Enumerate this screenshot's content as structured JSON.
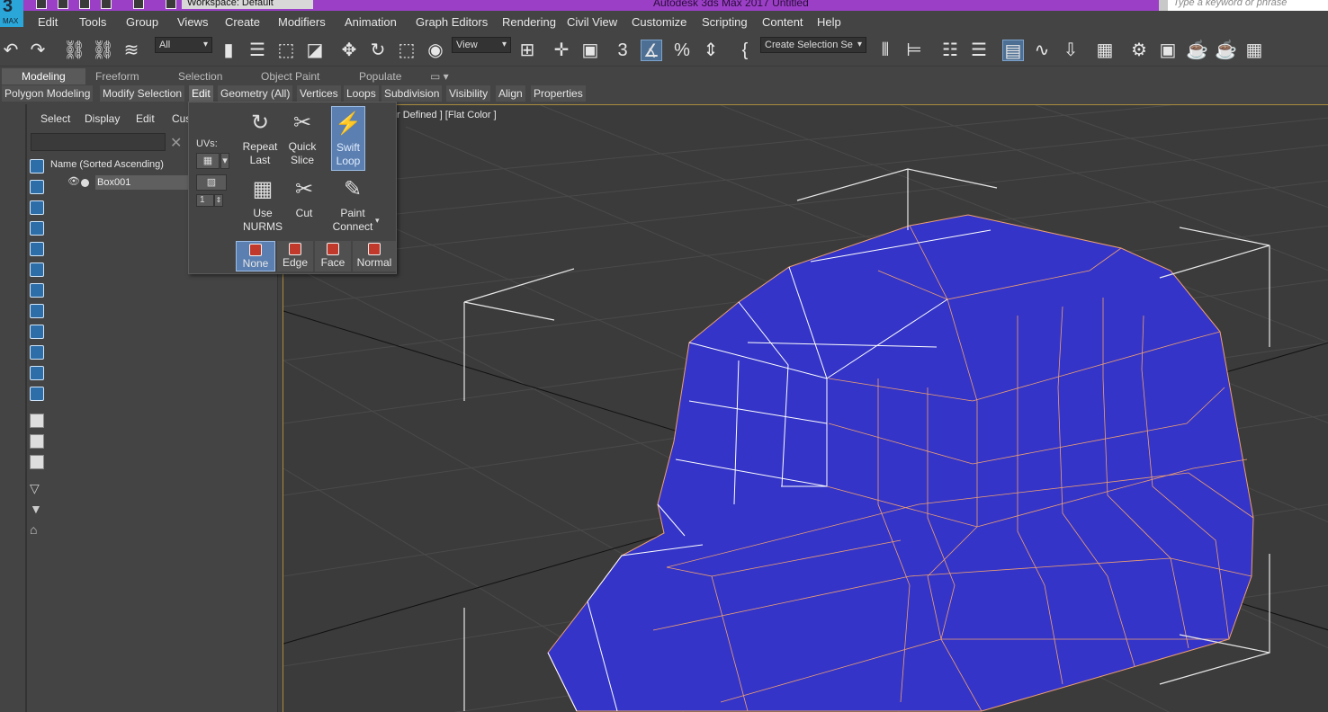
{
  "title_bar": {
    "text": "Autodesk 3ds Max 2017     Untitled",
    "workspace": "Workspace: Default",
    "search_placeholder": "Type a keyword or phrase",
    "logo": "3",
    "logo_label": "MAX"
  },
  "menu": [
    "Edit",
    "Tools",
    "Group",
    "Views",
    "Create",
    "Modifiers",
    "Animation",
    "Graph Editors",
    "Rendering",
    "Civil View",
    "Customize",
    "Scripting",
    "Content",
    "Help"
  ],
  "toolbar": {
    "filter_value": "All",
    "view_value": "View",
    "selection_set": "Create Selection Se"
  },
  "ribbon_tabs": [
    "Modeling",
    "Freeform",
    "Selection",
    "Object Paint",
    "Populate"
  ],
  "sub_tabs": [
    "Polygon Modeling",
    "Modify Selection",
    "Edit",
    "Geometry (All)",
    "Vertices",
    "Loops",
    "Subdivision",
    "Visibility",
    "Align",
    "Properties"
  ],
  "scene_explorer": {
    "menu": [
      "Select",
      "Display",
      "Edit",
      "Cus"
    ],
    "header": "Name (Sorted Ascending)",
    "object": "Box001"
  },
  "viewport": {
    "label": "r Defined ] [Flat Color ]"
  },
  "edit_popup": {
    "uvs_label": "UVs:",
    "spinner_value": "1",
    "tools": [
      {
        "label1": "Repeat",
        "label2": "Last"
      },
      {
        "label1": "Quick",
        "label2": "Slice"
      },
      {
        "label1": "Swift",
        "label2": "Loop"
      },
      {
        "label1": "Use",
        "label2": "NURMS"
      },
      {
        "label1": "Cut",
        "label2": ""
      },
      {
        "label1": "Paint",
        "label2": "Connect"
      }
    ],
    "constraints": [
      "None",
      "Edge",
      "Face",
      "Normal"
    ]
  },
  "colors": {
    "title_bar": "#9b40c6",
    "mesh_fill": "#3434c8",
    "selection_highlight": "#5b7fb0",
    "viewport_border": "#a98c3c"
  }
}
